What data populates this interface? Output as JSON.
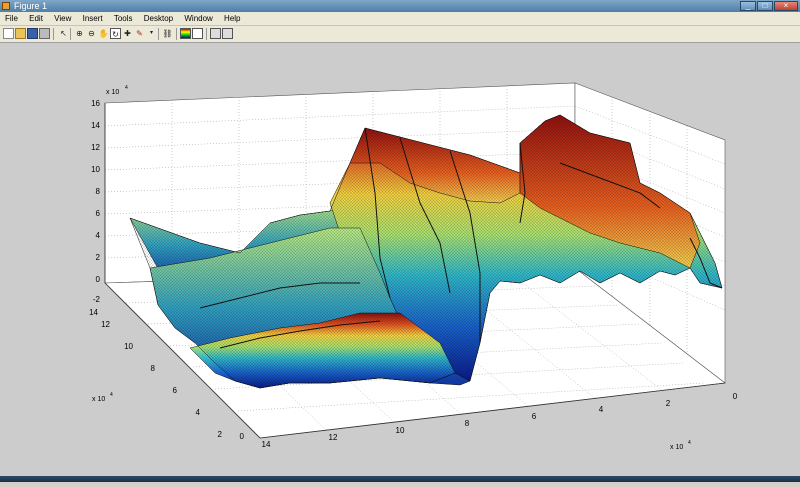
{
  "window": {
    "title": "Figure 1"
  },
  "menu": [
    "File",
    "Edit",
    "View",
    "Insert",
    "Tools",
    "Desktop",
    "Window",
    "Help"
  ],
  "toolbar": {
    "icons": [
      "new-file-icon",
      "open-file-icon",
      "save-icon",
      "print-icon",
      "pointer-icon",
      "zoom-in-icon",
      "zoom-out-icon",
      "pan-icon",
      "rotate-icon",
      "data-cursor-icon",
      "brush-icon",
      "link-icon",
      "colorbar-icon",
      "legend-icon",
      "hide-tools-icon",
      "show-tools-icon"
    ]
  },
  "plot": {
    "z_ticks": [
      "16",
      "14",
      "12",
      "10",
      "8",
      "6",
      "4",
      "2",
      "0",
      "-2"
    ],
    "z_exponent": "x 10",
    "z_exponent_power": "4",
    "y_ticks": [
      "14",
      "12",
      "10",
      "8",
      "6",
      "4",
      "2",
      "0"
    ],
    "y_exponent": "x 10",
    "y_exponent_power": "4",
    "x_ticks": [
      "14",
      "12",
      "10",
      "8",
      "6",
      "4",
      "2",
      "0"
    ],
    "x_exponent": "x 10",
    "x_exponent_power": "4"
  }
}
